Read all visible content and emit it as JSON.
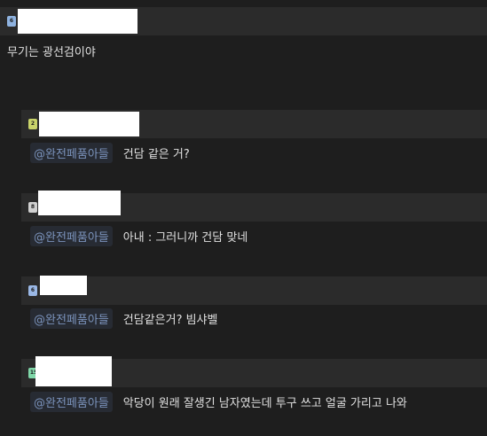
{
  "post": {
    "level": "6",
    "level_color": "#8fb3e0",
    "text": "무기는 광선검이야"
  },
  "replies": [
    {
      "level": "2",
      "level_color": "#c9d36a",
      "mention": "@완전페품아들",
      "text": "건담 같은 거?"
    },
    {
      "level": "8",
      "level_color": "#d0d0d0",
      "mention": "@완전페품아들",
      "text": "아내 : 그러니까 건담 맞네"
    },
    {
      "level": "6",
      "level_color": "#9ab8e6",
      "mention": "@완전페품아들",
      "text": "건담같은거? 빔샤벨"
    },
    {
      "level": "15",
      "level_color": "#7fd6a8",
      "mention": "@완전페품아들",
      "text": "악당이 원래 잘생긴 남자였는데 투구 쓰고 얼굴 가리고 나와"
    }
  ]
}
